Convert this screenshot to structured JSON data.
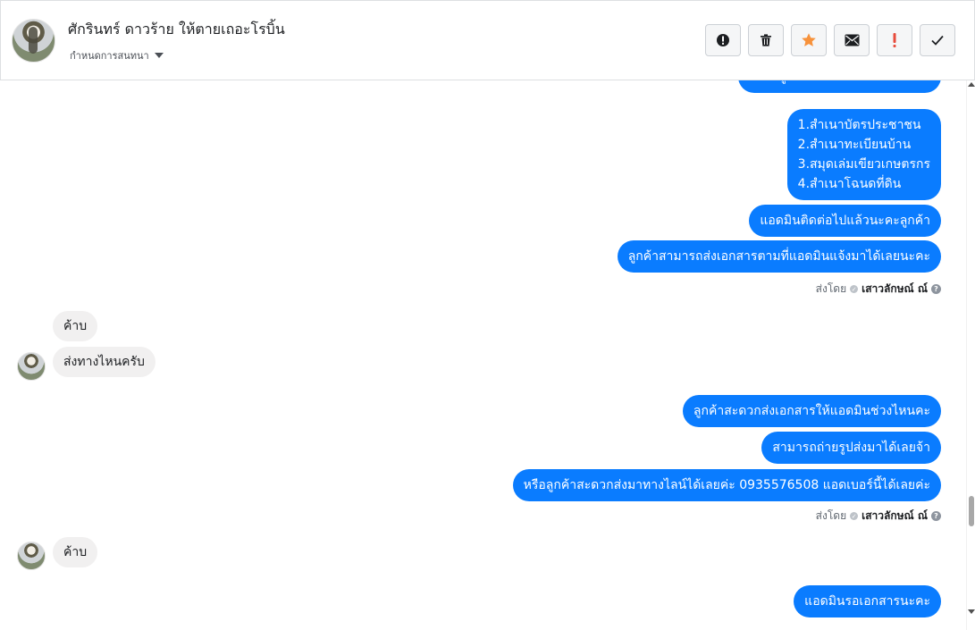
{
  "header": {
    "contact_name": "ศักรินทร์ ดาวร้าย ให้ตายเถอะโรบิ้น",
    "assign_label": "กำหนดการสนทนา"
  },
  "toolbar": {
    "buttons": [
      {
        "name": "report-icon",
        "symbol": "!"
      },
      {
        "name": "trash-icon",
        "symbol": "trash"
      },
      {
        "name": "star-icon",
        "symbol": "star",
        "color": "#f7923b"
      },
      {
        "name": "mail-icon",
        "symbol": "mail"
      },
      {
        "name": "important-icon",
        "symbol": "!",
        "color": "#e74c3c"
      },
      {
        "name": "done-icon",
        "symbol": "check"
      }
    ]
  },
  "messages": {
    "top_partial": "ได้คะลูกค้า แอดมินติดต่อไปนะคะ",
    "doc_list": [
      "1.สำเนาบัตรประชาชน",
      "2.สำเนาทะเบียนบ้าน",
      "3.สมุดเล่มเขียวเกษตรกร",
      "4.สำเนาโฉนดที่ดิน"
    ],
    "out_1": "แอดมินติดต่อไปแล้วนะคะลูกค้า",
    "out_2": "ลูกค้าสามารถส่งเอกสารตามที่แอดมินแจ้งมาได้เลยนะคะ",
    "sent_by_1": {
      "prefix": "ส่งโดย",
      "agent": "เสาวลักษณ์ ณ์"
    },
    "in_1": "ค้าบ",
    "in_2": "ส่งทางไหนครับ",
    "out_3": "ลูกค้าสะดวกส่งเอกสารให้แอดมินช่วงไหนคะ",
    "out_4": "สามารถถ่ายรูปส่งมาได้เลยจ้า",
    "out_5": "หรือลูกค้าสะดวกส่งมาทางไลน์ได้เลยค่ะ 0935576508 แอดเบอร์นี้ได้เลยค่ะ",
    "sent_by_2": {
      "prefix": "ส่งโดย",
      "agent": "เสาวลักษณ์ ณ์"
    },
    "in_3": "ค้าบ",
    "out_6": "แอดมินรอเอกสารนะคะ"
  },
  "colors": {
    "outgoing_bubble": "#0a7cff",
    "incoming_bubble": "#f1f0f0"
  }
}
